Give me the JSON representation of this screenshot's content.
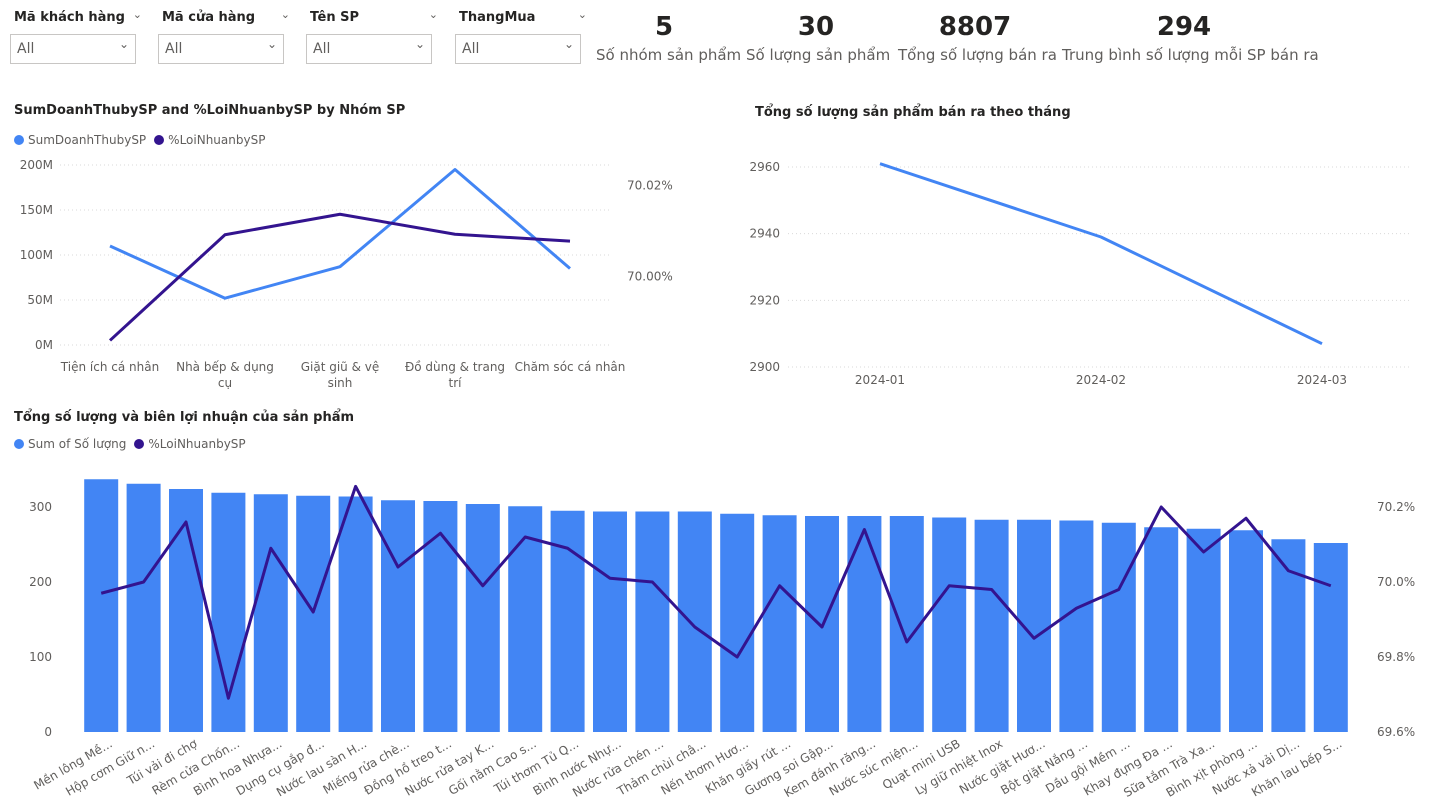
{
  "slicers": [
    {
      "label": "Mã khách hàng",
      "value": "All"
    },
    {
      "label": "Mã cửa hàng",
      "value": "All"
    },
    {
      "label": "Tên SP",
      "value": "All"
    },
    {
      "label": "ThangMua",
      "value": "All"
    }
  ],
  "kpis": [
    {
      "value": "5",
      "caption": "Số nhóm sản phẩm"
    },
    {
      "value": "30",
      "caption": "Số lượng sản phẩm"
    },
    {
      "value": "8807",
      "caption": "Tổng số lượng bán ra"
    },
    {
      "value": "294",
      "caption": "Trung bình số lượng mỗi SP bán ra"
    }
  ],
  "colors": {
    "blue": "#4285F4",
    "purple": "#33148F",
    "grid": "#d9d9d9",
    "axis": "#605e5c"
  },
  "chart_data": [
    {
      "id": "group",
      "type": "line",
      "title": "SumDoanhThubySP and %LoiNhuanbySP by Nhóm SP",
      "categories": [
        "Tiện ích cá nhân",
        "Nhà bếp & dụng cụ",
        "Giặt giũ & vệ sinh",
        "Đồ dùng & trang trí",
        "Chăm sóc cá nhân"
      ],
      "series": [
        {
          "name": "SumDoanhThubySP",
          "axis": "left",
          "values": [
            110000000,
            52000000,
            87000000,
            195000000,
            85000000
          ]
        },
        {
          "name": "%LoiNhuanbySP",
          "axis": "right",
          "values": [
            69.986,
            70.0092,
            70.0137,
            70.0093,
            70.0078
          ]
        }
      ],
      "y_left": {
        "ticks": [
          "0M",
          "50M",
          "100M",
          "150M",
          "200M"
        ],
        "range": [
          0,
          200000000
        ]
      },
      "y_right": {
        "ticks": [
          "70.00%",
          "70.02%"
        ],
        "range": [
          69.985,
          70.0245
        ]
      }
    },
    {
      "id": "monthly",
      "type": "line",
      "title": "Tổng số lượng sản phẩm bán ra theo tháng",
      "categories": [
        "2024-01",
        "2024-02",
        "2024-03"
      ],
      "series": [
        {
          "name": "Tổng số lượng",
          "values": [
            2961,
            2939,
            2907
          ]
        }
      ],
      "y": {
        "ticks": [
          "2900",
          "2920",
          "2940",
          "2960"
        ],
        "range": [
          2900,
          2960
        ]
      }
    },
    {
      "id": "product",
      "type": "bar",
      "title": "Tổng số lượng và biên lợi nhuận của sản phẩm",
      "categories": [
        "Mền lông Mề...",
        "Hộp cơm Giữ n...",
        "Túi vải đi chợ",
        "Rèm cửa Chốn...",
        "Bình hoa Nhựa...",
        "Dụng cụ gắp đ...",
        "Nước lau sàn H...",
        "Miếng rửa chè...",
        "Đồng hồ treo t...",
        "Nước rửa tay K...",
        "Gối nằm Cao s...",
        "Túi thơm Tủ Q...",
        "Bình nước Nhự...",
        "Nước rửa chén ...",
        "Thảm chùi châ...",
        "Nến thơm Hươ...",
        "Khăn giấy rút ...",
        "Gương soi Gập...",
        "Kem đánh răng...",
        "Nước súc miện...",
        "Quạt mini USB",
        "Ly giữ nhiệt Inox",
        "Nước giặt Hươ...",
        "Bột giặt Nắng ...",
        "Dầu gội Mềm ...",
        "Khay đựng Đa ...",
        "Sữa tắm Trà Xa...",
        "Bình xịt phòng ...",
        "Nước xả vải Dị...",
        "Khăn lau bếp S..."
      ],
      "series": [
        {
          "name": "Sum of Số lượng",
          "axis": "left",
          "values": [
            337,
            331,
            324,
            319,
            317,
            315,
            314,
            309,
            308,
            304,
            301,
            295,
            294,
            294,
            294,
            291,
            289,
            288,
            288,
            288,
            286,
            283,
            283,
            282,
            279,
            273,
            271,
            269,
            257,
            252
          ]
        },
        {
          "name": "%LoiNhuanbySP",
          "axis": "right",
          "values": [
            69.97,
            70.0,
            70.16,
            69.69,
            70.09,
            69.92,
            70.255,
            70.04,
            70.13,
            69.99,
            70.12,
            70.09,
            70.01,
            70.0,
            69.88,
            69.8,
            69.99,
            69.88,
            70.14,
            69.84,
            69.99,
            69.98,
            69.85,
            69.93,
            69.98,
            70.2,
            70.08,
            70.17,
            70.03,
            69.99
          ]
        }
      ],
      "y_left": {
        "ticks": [
          "0",
          "100",
          "200",
          "300"
        ],
        "range": [
          0,
          300
        ]
      },
      "y_right": {
        "ticks": [
          "69.6%",
          "69.8%",
          "70.0%",
          "70.2%"
        ],
        "range": [
          69.6,
          70.2
        ]
      }
    }
  ]
}
